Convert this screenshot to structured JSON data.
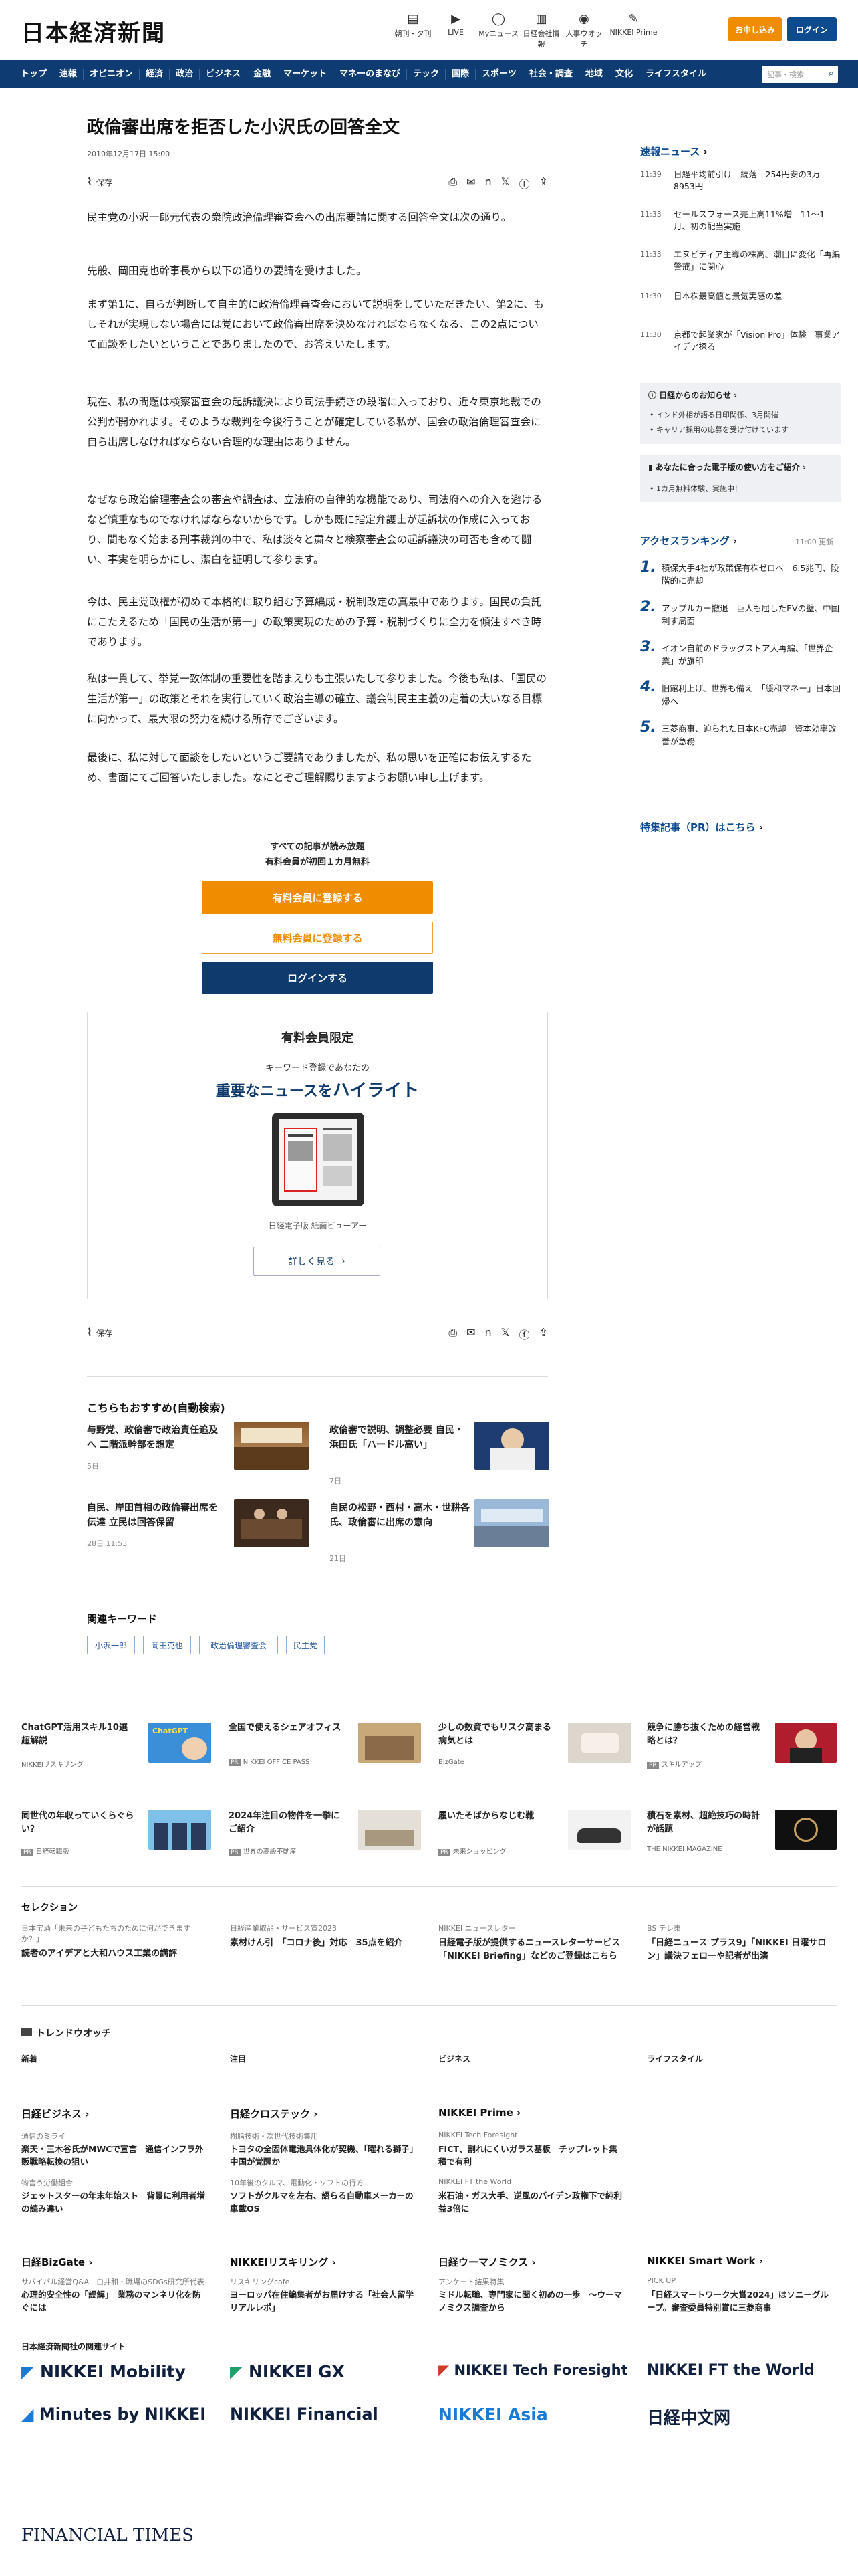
{
  "header": {
    "logo": "日本経済新聞",
    "icons": [
      {
        "label": "朝刊・夕刊",
        "icon": "newspaper-icon",
        "glyph": "▤"
      },
      {
        "label": "LIVE",
        "icon": "live-icon",
        "glyph": "▶"
      },
      {
        "label": "Myニュース",
        "icon": "user-icon",
        "glyph": "◯"
      },
      {
        "label": "日経会社情報",
        "icon": "company-icon",
        "glyph": "▥"
      },
      {
        "label": "人事ウオッチ",
        "icon": "watch-icon",
        "glyph": "◉"
      },
      {
        "label": "NIKKEI Prime",
        "icon": "prime-icon",
        "glyph": "✎"
      }
    ],
    "subscribe_label": "お申し込み",
    "login_label": "ログイン"
  },
  "nav": {
    "items": [
      "トップ",
      "速報",
      "オピニオン",
      "経済",
      "政治",
      "ビジネス",
      "金融",
      "マーケット",
      "マネーのまなび",
      "テック",
      "国際",
      "スポーツ",
      "社会・調査",
      "地域",
      "文化",
      "ライフスタイル"
    ],
    "search_placeholder": "記事・検索"
  },
  "article": {
    "title": "政倫審出席を拒否した小沢氏の回答全文",
    "date": "2010年12月17日 15:00",
    "save_label": "保存",
    "paragraphs": [
      "民主党の小沢一郎元代表の衆院政治倫理審査会への出席要請に関する回答全文は次の通り。",
      "先般、岡田克也幹事長から以下の通りの要請を受けました。",
      "まず第1に、自らが判断して自主的に政治倫理審査会において説明をしていただきたい、第2に、もしそれが実現しない場合には党において政倫審出席を決めなければならなくなる、この2点について面談をしたいということでありましたので、お答えいたします。",
      "現在、私の問題は検察審査会の起訴議決により司法手続きの段階に入っており、近々東京地裁での公判が開かれます。そのような裁判を今後行うことが確定している私が、国会の政治倫理審査会に自ら出席しなければならない合理的な理由はありません。",
      "なぜなら政治倫理審査会の審査や調査は、立法府の自律的な機能であり、司法府への介入を避けるなど慎重なものでなければならないからです。しかも既に指定弁護士が起訴状の作成に入っており、間もなく始まる刑事裁判の中で、私は淡々と粛々と検察審査会の起訴議決の可否も含めて闘い、事実を明らかにし、潔白を証明して参ります。",
      "今は、民主党政権が初めて本格的に取り組む予算編成・税制改定の真最中であります。国民の負託にこたえるため「国民の生活が第一」の政策実現のための予算・税制づくりに全力を傾注すべき時であります。",
      "私は一貫して、挙党一致体制の重要性を踏まえりも主張いたして参りました。今後も私は、「国民の生活が第一」の政策とそれを実行していく政治主導の確立、議会制民主主義の定着の大いなる目標に向かって、最大限の努力を続ける所存でございます。",
      "最後に、私に対して面談をしたいというご要請でありましたが、私の思いを正確にお伝えするため、書面にてご回答いたしました。なにとぞご理解賜りますようお願い申し上げます。"
    ]
  },
  "paywall": {
    "line1": "すべての記事が読み放題",
    "line2": "有料会員が初回１カ月無料",
    "btn_paid": "有料会員に登録する",
    "btn_free": "無料会員に登録する",
    "btn_login": "ログインする",
    "box_title": "有料会員限定",
    "box_sub": "キーワード登録であなたの",
    "box_headline_a": "重要なニュースを",
    "box_headline_b": "ハイライト",
    "viewer_caption": "日経電子版 紙面ビューアー",
    "more_label": "詳しく見る"
  },
  "sidebar": {
    "breaking_title": "速報ニュース",
    "breaking": [
      {
        "time": "11:39",
        "text": "日経平均前引け　続落　254円安の3万8953円"
      },
      {
        "time": "11:33",
        "text": "セールスフォース売上高11%増　11～1月、初の配当実施"
      },
      {
        "time": "11:33",
        "text": "エヌビディア主導の株高、潮目に変化「再編警戒」に関心"
      },
      {
        "time": "11:30",
        "text": "日本株最高値と景気実感の差"
      },
      {
        "time": "11:30",
        "text": "京都で起業家が「Vision Pro」体験　事業アイデア探る"
      }
    ],
    "notice_title": "日経からのお知らせ",
    "notices": [
      "インド外相が語る日印関係、3月開催",
      "キャリア採用の応募を受け付けています"
    ],
    "guide_title": "あなたに合った電子版の使い方をご紹介",
    "guide_item": "1カ月無料体験、実施中！",
    "ranking_title": "アクセスランキング",
    "ranking_updated": "11:00 更新",
    "ranking": [
      "積保大手4社が政策保有株ゼロへ　6.5兆円、段階的に売却",
      "アップルカー撤退　巨人も屈したEVの壁、中国利す局面",
      "イオン自前のドラッグストア大再編、「世界企業」が旗印",
      "旧館利上げ、世界も備え　「緩和マネー」日本回帰へ",
      "三菱商事、迫られた日本KFC売却　資本効率改善が急務"
    ],
    "pr_title": "特集記事（PR）はこちら"
  },
  "recommend": {
    "title": "こちらもおすすめ(自動検索)",
    "items": [
      {
        "title": "与野党、政倫審で政治責任追及へ 二階派幹部を想定",
        "date": "5日"
      },
      {
        "title": "政倫審で説明、調整必要 自民・浜田氏「ハードル高い」",
        "date": "7日"
      },
      {
        "title": "自民、岸田首相の政倫審出席を伝達 立民は回答保留",
        "date": "28日 11:53"
      },
      {
        "title": "自民の松野・西村・高木・世耕各氏、政倫審に出席の意向",
        "date": "21日"
      }
    ]
  },
  "keywords": {
    "title": "関連キーワード",
    "items": [
      "小沢一郎",
      "岡田克也",
      "政治倫理審査会",
      "民主党"
    ]
  },
  "ads": [
    {
      "title": "ChatGPT活用スキル10選超解説",
      "src": "NIKKEIリスキリング",
      "badge": ""
    },
    {
      "title": "全国で使えるシェアオフィス",
      "src": "NIKKEI OFFICE PASS",
      "badge": "PR"
    },
    {
      "title": "少しの数資でもリスク高まる病気とは",
      "src": "BizGate",
      "badge": ""
    },
    {
      "title": "競争に勝ち抜くための経営戦略とは？",
      "src": "スキルアップ",
      "badge": "PR"
    },
    {
      "title": "同世代の年収っていくらぐらい？",
      "src": "日経転職版",
      "badge": "PR"
    },
    {
      "title": "2024年注目の物件を一挙にご紹介",
      "src": "世界の高級不動産",
      "badge": "PR"
    },
    {
      "title": "履いたそばからなじむ靴",
      "src": "未来ショッピング",
      "badge": "PR"
    },
    {
      "title": "積石を素材、超絶技巧の時計が話題",
      "src": "THE NIKKEI MAGAZINE",
      "badge": ""
    }
  ],
  "selection": {
    "title": "セレクション",
    "items": [
      {
        "src": "日本宝酒「未来の子どもたちのために何ができますか？」",
        "title": "読者のアイデアと大和ハウス工業の講評"
      },
      {
        "src": "日経産業取品・サービス賞2023",
        "title": "素材けん引　「コロナ後」対応　35点を紹介"
      },
      {
        "src": "NIKKEI ニュースレター",
        "title": "日経電子版が提供するニュースレターサービス「NIKKEI Briefing」などのご登録はこちら"
      },
      {
        "src": "BS テレ東",
        "title": "「日経ニュース プラス9」「NIKKEI 日曜サロン」議決フェローや記者が出演"
      }
    ]
  },
  "trend": {
    "title": "トレンドウオッチ",
    "cols": [
      "新着",
      "注目",
      "ビジネス",
      "ライフスタイル"
    ]
  },
  "groups": [
    {
      "name": "日経ビジネス",
      "items": [
        {
          "s": "通信のミライ",
          "t": "楽天・三木谷氏がMWCで宣言　通信インフラ外販戦略転換の狙い"
        },
        {
          "s": "物言う労働組合",
          "t": "ジェットスターの年末年始スト　背景に利用者増の読み違い"
        }
      ]
    },
    {
      "name": "日経クロステック",
      "items": [
        {
          "s": "樹脂技術・次世代技術集用",
          "t": "トヨタの全固体電池具体化が契機、「曜れる獅子」中国が覚醒か"
        },
        {
          "s": "10年後のクルマ、電動化・ソフトの行方",
          "t": "ソフトがクルマを左右、語らる自動車メーカーの車載OS"
        }
      ]
    },
    {
      "name": "NIKKEI Prime",
      "items": [
        {
          "s": "NIKKEI Tech Foresight",
          "t": "FICT、割れにくいガラス基板　チップレット集積で有利"
        },
        {
          "s": "NIKKEI FT the World",
          "t": "米石油・ガス大手、逆風のバイデン政権下で純利益3倍に"
        }
      ]
    },
    {
      "name": "日経BizGate",
      "items": [
        {
          "s": "サバイバル経営Q&A　白井和・職場のSDGs研究所代表",
          "t": "心理的安全性の「誤解」　業務のマンネリ化を防ぐには"
        }
      ]
    },
    {
      "name": "NIKKEIリスキリング",
      "items": [
        {
          "s": "リスキリングcafe",
          "t": "ヨーロッパ在住編集者がお届けする「社会人留学リアルレポ」"
        }
      ]
    },
    {
      "name": "日経ウーマノミクス",
      "items": [
        {
          "s": "アンケート結果特集",
          "t": "ミドル転職、専門家に聞く初めの一歩　～ウーマノミクス調査から"
        }
      ]
    },
    {
      "name": "NIKKEI Smart Work",
      "items": [
        {
          "s": "PICK UP",
          "t": "「日経スマートワーク大賞2024」はソニーグループ。審査委員特別賞に三菱商事"
        }
      ]
    }
  ],
  "related": {
    "title": "日本経済新聞社の関連サイト",
    "brands": [
      "NIKKEI Mobility",
      "NIKKEI GX",
      "NIKKEI Tech Foresight",
      "NIKKEI FT the World",
      "Minutes by NIKKEI",
      "NIKKEI Financial",
      "NIKKEI Asia",
      "日経中文网",
      "FINANCIAL TIMES"
    ]
  },
  "colors": {
    "navy": "#0d3b72",
    "orange": "#f08c00",
    "blue": "#0e4a8e"
  }
}
